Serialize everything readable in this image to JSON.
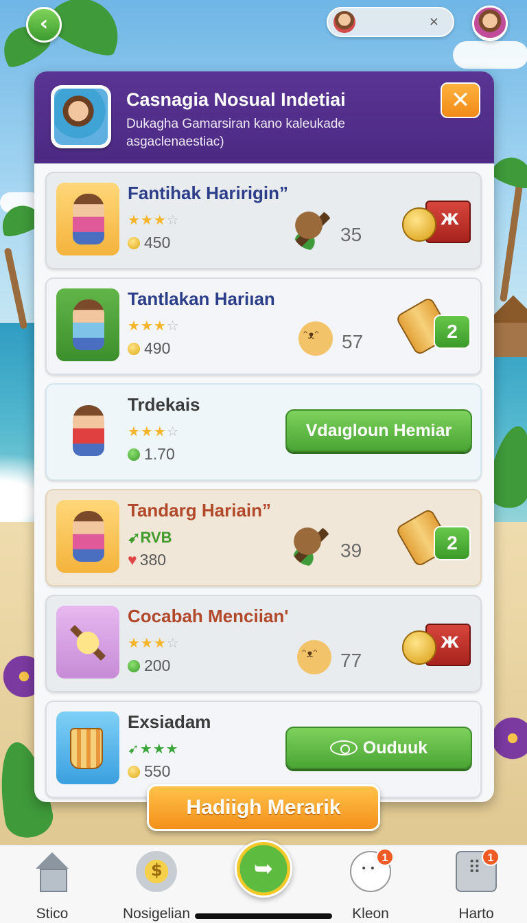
{
  "header": {
    "title": "Casnagia Nosual Indetiai",
    "subtitle": "Dukagha Gamarsiran kano kaleukade asgaclenaestiac)"
  },
  "top_bar": {
    "back_icon": "chevron-left-icon",
    "pill_close": "×"
  },
  "cards": [
    {
      "title": "Fantihak Haririgin”",
      "stars": "★★★☆",
      "cost": "450",
      "cost_type": "coin",
      "item_count": "35",
      "reward": "chest"
    },
    {
      "title": "Tantlakan Hariıan",
      "stars": "★★★☆",
      "cost": "490",
      "cost_type": "coin",
      "item_count": "57",
      "reward": "pastry",
      "reward_badge": "2"
    },
    {
      "title": "Trdekais",
      "stars": "★★★☆",
      "cost": "1.70",
      "cost_type": "gem",
      "button_label": "Vdaıgloun Hemiar"
    },
    {
      "title": "Tandarg Hariain”",
      "badge": "RVB",
      "cost": "380",
      "cost_type": "heart",
      "item_count": "39",
      "reward": "pastry",
      "reward_badge": "2"
    },
    {
      "title": "Cocabah Menciian'",
      "stars": "★★★☆",
      "cost": "200",
      "cost_type": "gem",
      "item_count": "77",
      "reward": "chest"
    },
    {
      "title": "Exsiadam",
      "stars": "★★★",
      "cost": "550",
      "cost_type": "coin",
      "button_label": "Ouduuk"
    }
  ],
  "cta_label": "Hadiigh Merarik",
  "nav": {
    "items": [
      {
        "label": "Stico",
        "icon": "home-icon"
      },
      {
        "label": "Nosigelian",
        "icon": "coin-gear-icon"
      },
      {
        "label": "",
        "icon": "center-action-icon"
      },
      {
        "label": "Kleon",
        "icon": "face-icon",
        "badge": "1"
      },
      {
        "label": "Harto",
        "icon": "computer-icon",
        "badge": "1"
      }
    ]
  },
  "colors": {
    "header_purple": "#4b2a83",
    "accent_green": "#4aa534",
    "accent_orange": "#f3901a",
    "title_blue": "#2c3d8a",
    "title_red": "#b2482a"
  }
}
